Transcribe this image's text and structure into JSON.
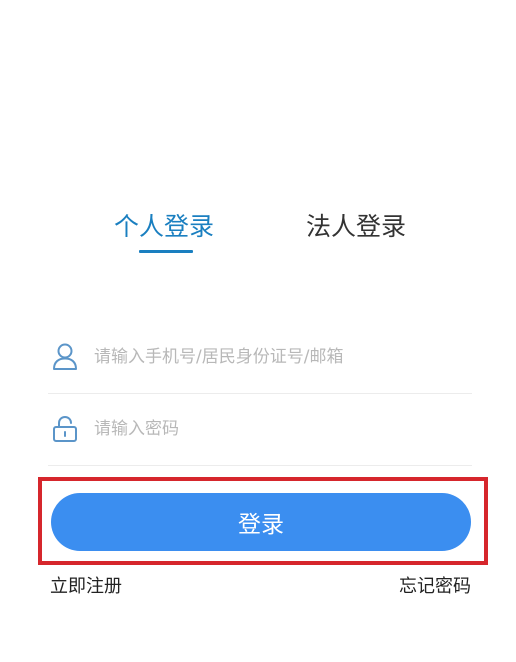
{
  "tabs": {
    "personal_label": "个人登录",
    "legal_label": "法人登录",
    "active": "personal"
  },
  "form": {
    "account_placeholder": "请输入手机号/居民身份证号/邮箱",
    "account_value": "",
    "account_icon": "user-icon",
    "password_placeholder": "请输入密码",
    "password_value": "",
    "password_icon": "lock-icon"
  },
  "login_button_label": "登录",
  "links": {
    "register_label": "立即注册",
    "forgot_label": "忘记密码"
  },
  "colors": {
    "accent": "#1a7fc0",
    "button": "#3b8ef0",
    "highlight": "#d6262c",
    "placeholder": "#b8b8b8"
  }
}
